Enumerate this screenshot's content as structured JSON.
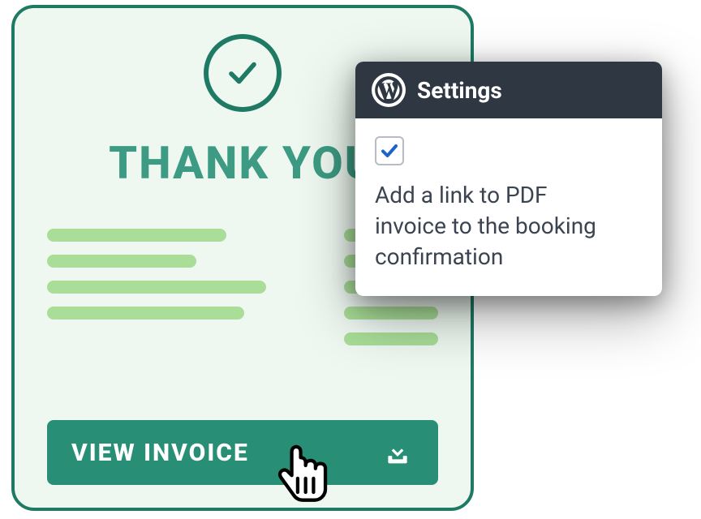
{
  "card": {
    "heading": "THANK YOU",
    "button_label": "VIEW INVOICE",
    "icons": {
      "check": "check-icon",
      "download": "download-icon"
    }
  },
  "settings": {
    "title": "Settings",
    "option_label": "Add a link to PDF invoice to the booking confirmation",
    "option_checked": true,
    "icons": {
      "logo": "wordpress-icon",
      "checkbox_tick": "check-icon"
    }
  },
  "pointer": {
    "icon": "pointer-hand-icon"
  },
  "colors": {
    "accent": "#1f7a63",
    "accent_light": "#3c9b82",
    "button": "#288f76",
    "placeholder_bar": "#a9dd98",
    "header_dark": "#2f3743",
    "check_blue": "#1e63c9"
  }
}
